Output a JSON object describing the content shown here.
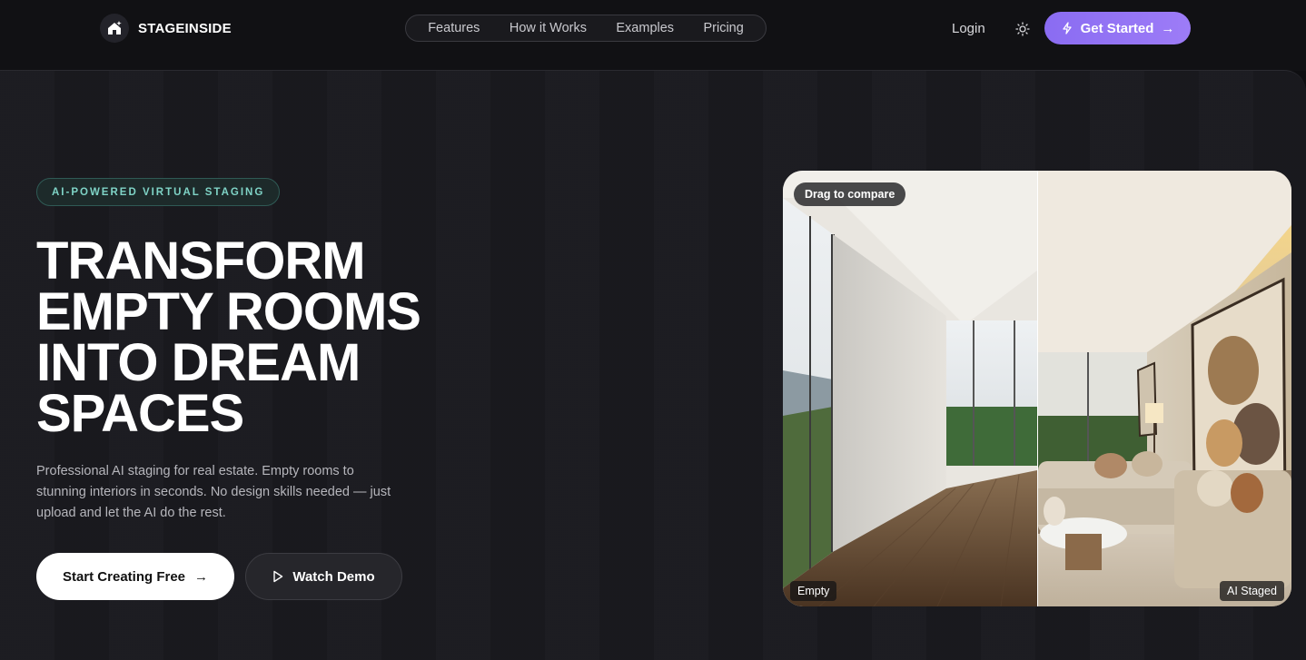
{
  "brand": {
    "name": "STAGEINSIDE",
    "logo_icon": "house-sparkle-icon"
  },
  "nav": {
    "items": [
      "Features",
      "How it Works",
      "Examples",
      "Pricing"
    ]
  },
  "header": {
    "login_label": "Login",
    "theme_icon": "sun-icon",
    "cta_label": "Get Started",
    "cta_icon": "lightning-icon",
    "cta_color": "#8b6cf3"
  },
  "hero": {
    "badge": "AI-POWERED VIRTUAL STAGING",
    "headline_lines": [
      "TRANSFORM",
      "EMPTY ROOMS",
      "INTO DREAM",
      "SPACES"
    ],
    "subtitle": "Professional AI staging for real estate. Empty rooms to stunning interiors in seconds. No design skills needed — just upload and let the AI do the rest.",
    "primary_button": "Start Creating Free",
    "secondary_button": "Watch Demo"
  },
  "compare": {
    "hint": "Drag to compare",
    "left_label": "Empty",
    "right_label": "AI Staged"
  }
}
